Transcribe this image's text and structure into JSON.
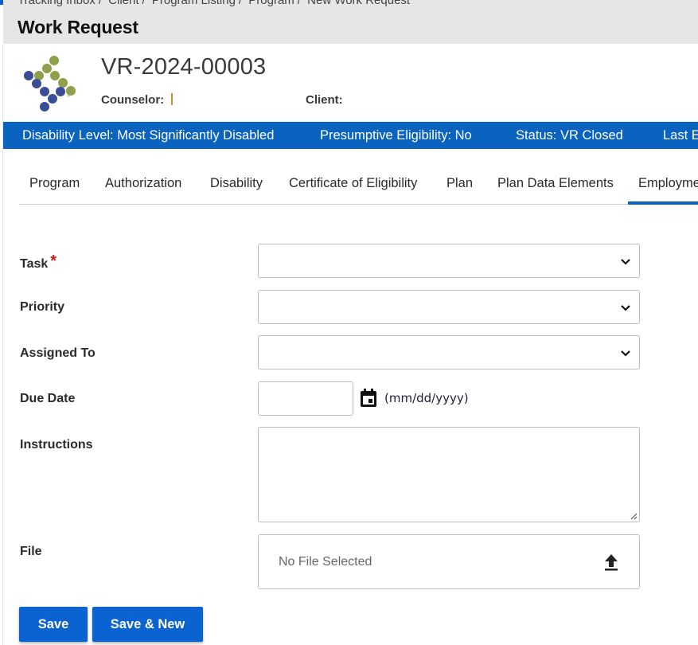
{
  "breadcrumb": [
    "Tracking Inbox",
    "Client",
    "Program Listing",
    "Program",
    "New Work Request"
  ],
  "breadcrumb_separator": "/",
  "page_title": "Work Request",
  "case": {
    "id": "VR-2024-00003",
    "counselor_label": "Counselor:",
    "counselor_value": "",
    "client_label": "Client:",
    "client_value": ""
  },
  "status_bar": {
    "disability_level": "Disability Level: Most Significantly Disabled",
    "presumptive_eligibility": "Presumptive Eligibility: No",
    "status": "Status: VR Closed",
    "last_truncated": "Last E"
  },
  "tabs": [
    {
      "label": "Program",
      "active": false
    },
    {
      "label": "Authorization",
      "active": false
    },
    {
      "label": "Disability",
      "active": false
    },
    {
      "label": "Certificate of Eligibility",
      "active": false
    },
    {
      "label": "Plan",
      "active": false
    },
    {
      "label": "Plan Data Elements",
      "active": false
    },
    {
      "label": "Employme",
      "active": true
    }
  ],
  "form": {
    "task": {
      "label": "Task",
      "required_mark": "*",
      "value": ""
    },
    "priority": {
      "label": "Priority",
      "value": ""
    },
    "assigned_to": {
      "label": "Assigned To",
      "value": ""
    },
    "due_date": {
      "label": "Due Date",
      "value": "",
      "hint": "(mm/dd/yyyy)"
    },
    "instructions": {
      "label": "Instructions",
      "value": ""
    },
    "file": {
      "label": "File",
      "status": "No File Selected"
    }
  },
  "buttons": {
    "save": "Save",
    "save_new": "Save & New"
  },
  "colors": {
    "brand_blue": "#0a63bf",
    "button_blue": "#0a63d0",
    "logo_green": "#8fa04a",
    "logo_navy": "#3b4d96",
    "required_red": "#d01818"
  },
  "icons": {
    "select_chevron": "chevron-down-icon",
    "calendar": "calendar-icon",
    "upload": "upload-icon"
  }
}
